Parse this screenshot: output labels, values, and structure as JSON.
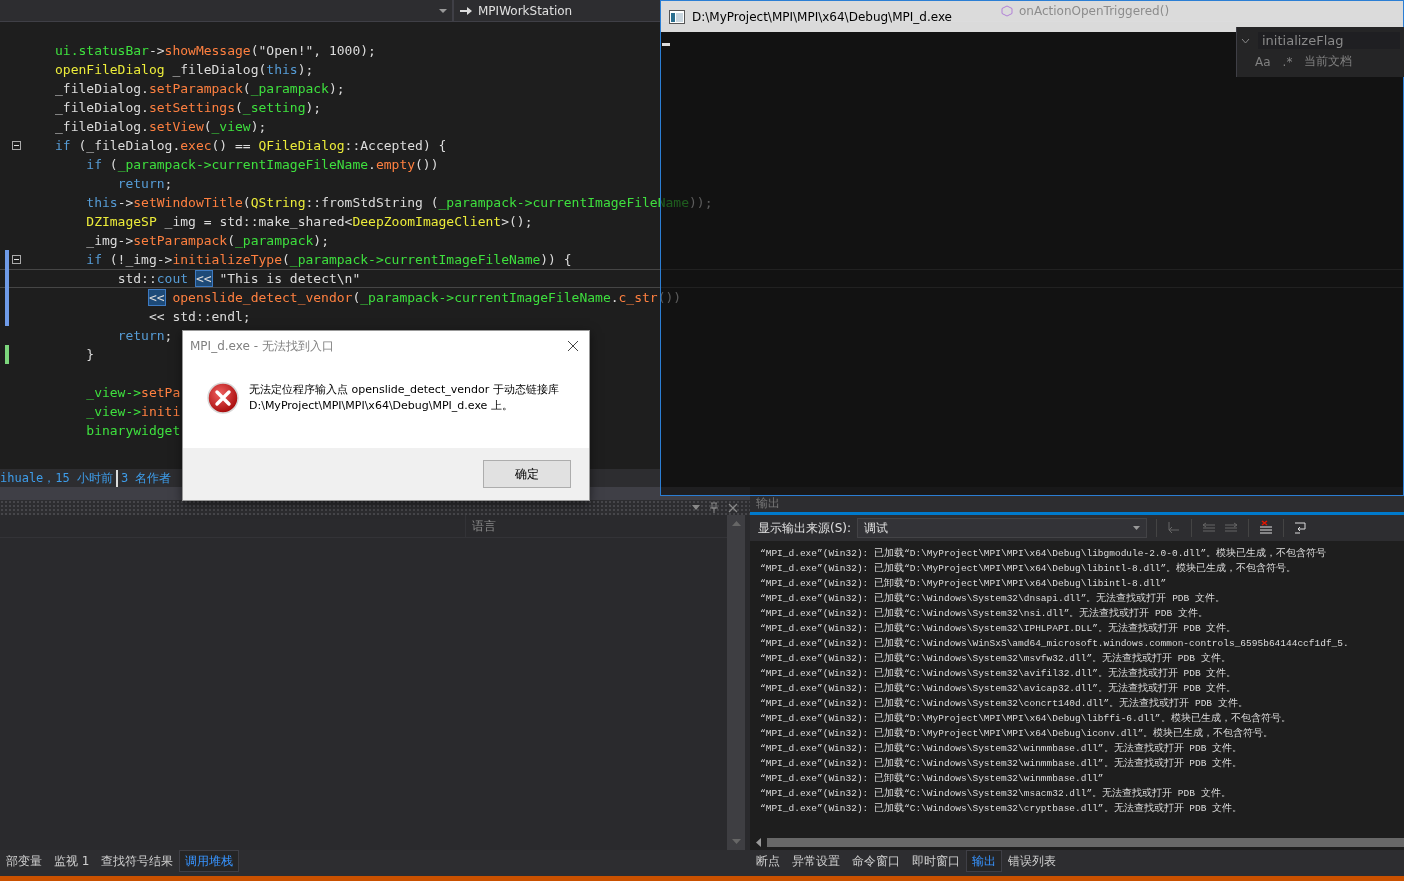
{
  "editor": {
    "navbar": {
      "project": "MPIWorkStation",
      "member": "onActionOpenTriggered()"
    },
    "blocks": [
      {
        "lines": [
          {
            "tokens": [
              {
                "text": "ui.statusBar",
                "kind": "member"
              },
              {
                "text": "->",
                "kind": "plain"
              },
              {
                "text": "showMessage",
                "kind": "function"
              },
              {
                "text": "(\"Open!\", 1000);",
                "kind": "plain"
              }
            ],
            "fold": false,
            "modified": false,
            "saved": false,
            "current": false
          },
          {
            "tokens": [
              {
                "text": "openFileDialog",
                "kind": "type"
              },
              {
                "text": " _fileDialog(",
                "kind": "plain"
              },
              {
                "text": "this",
                "kind": "keyword"
              },
              {
                "text": ");",
                "kind": "plain"
              }
            ],
            "fold": false,
            "modified": false,
            "saved": false,
            "current": false
          },
          {
            "tokens": [
              {
                "text": "_fileDialog.",
                "kind": "plain"
              },
              {
                "text": "setParampack",
                "kind": "function"
              },
              {
                "text": "(",
                "kind": "plain"
              },
              {
                "text": "_parampack",
                "kind": "member"
              },
              {
                "text": ");",
                "kind": "plain"
              }
            ],
            "fold": false,
            "modified": false,
            "saved": false,
            "current": false
          },
          {
            "tokens": [
              {
                "text": "_fileDialog.",
                "kind": "plain"
              },
              {
                "text": "setSettings",
                "kind": "function"
              },
              {
                "text": "(",
                "kind": "plain"
              },
              {
                "text": "_setting",
                "kind": "member"
              },
              {
                "text": ");",
                "kind": "plain"
              }
            ],
            "fold": false,
            "modified": false,
            "saved": false,
            "current": false
          },
          {
            "tokens": [
              {
                "text": "_fileDialog.",
                "kind": "plain"
              },
              {
                "text": "setView",
                "kind": "function"
              },
              {
                "text": "(",
                "kind": "plain"
              },
              {
                "text": "_view",
                "kind": "member"
              },
              {
                "text": ");",
                "kind": "plain"
              }
            ],
            "fold": false,
            "modified": false,
            "saved": false,
            "current": false
          },
          {
            "tokens": [
              {
                "text": "if",
                "kind": "keyword"
              },
              {
                "text": " (_fileDialog.",
                "kind": "plain"
              },
              {
                "text": "exec",
                "kind": "function"
              },
              {
                "text": "() == ",
                "kind": "plain"
              },
              {
                "text": "QFileDialog",
                "kind": "type"
              },
              {
                "text": "::Accepted) {",
                "kind": "plain"
              }
            ],
            "fold": true,
            "modified": false,
            "saved": false,
            "current": false
          },
          {
            "tokens": [
              {
                "text": "    if",
                "kind": "keyword"
              },
              {
                "text": " (",
                "kind": "plain"
              },
              {
                "text": "_parampack->currentImageFileName",
                "kind": "member"
              },
              {
                "text": ".",
                "kind": "plain"
              },
              {
                "text": "empty",
                "kind": "function"
              },
              {
                "text": "())",
                "kind": "plain"
              }
            ],
            "fold": false,
            "modified": false,
            "saved": false,
            "current": false
          },
          {
            "tokens": [
              {
                "text": "        return",
                "kind": "keyword"
              },
              {
                "text": ";",
                "kind": "plain"
              }
            ],
            "fold": false,
            "modified": false,
            "saved": false,
            "current": false
          },
          {
            "tokens": [
              {
                "text": "    this",
                "kind": "keyword"
              },
              {
                "text": "->",
                "kind": "plain"
              },
              {
                "text": "setWindowTitle",
                "kind": "function"
              },
              {
                "text": "(",
                "kind": "plain"
              },
              {
                "text": "QString",
                "kind": "type"
              },
              {
                "text": "::fromStdString (",
                "kind": "plain"
              },
              {
                "text": "_parampack->currentImageFileName",
                "kind": "member"
              },
              {
                "text": "));",
                "kind": "plain"
              }
            ],
            "fold": false,
            "modified": false,
            "saved": false,
            "current": false
          },
          {
            "tokens": [
              {
                "text": "    DZImageSP",
                "kind": "type"
              },
              {
                "text": " _img = std::make_shared<",
                "kind": "plain"
              },
              {
                "text": "DeepZoomImageClient",
                "kind": "type"
              },
              {
                "text": ">();",
                "kind": "plain"
              }
            ],
            "fold": false,
            "modified": false,
            "saved": false,
            "current": false
          },
          {
            "tokens": [
              {
                "text": "    _img->",
                "kind": "plain"
              },
              {
                "text": "setParampack",
                "kind": "function"
              },
              {
                "text": "(",
                "kind": "plain"
              },
              {
                "text": "_parampack",
                "kind": "member"
              },
              {
                "text": ");",
                "kind": "plain"
              }
            ],
            "fold": false,
            "modified": false,
            "saved": false,
            "current": false
          },
          {
            "tokens": [
              {
                "text": "    if",
                "kind": "keyword"
              },
              {
                "text": " (!_img->",
                "kind": "plain"
              },
              {
                "text": "initializeType",
                "kind": "function"
              },
              {
                "text": "(",
                "kind": "plain"
              },
              {
                "text": "_parampack->currentImageFileName",
                "kind": "member"
              },
              {
                "text": ")) {",
                "kind": "plain"
              }
            ],
            "fold": true,
            "modified": true,
            "saved": false,
            "current": false
          },
          {
            "tokens": [
              {
                "text": "        std::",
                "kind": "plain"
              },
              {
                "text": "cout ",
                "kind": "keyword"
              },
              {
                "text": "<<",
                "kind": "match"
              },
              {
                "text": " \"This is detect\\n\"",
                "kind": "plain"
              }
            ],
            "fold": false,
            "modified": true,
            "saved": false,
            "current": true
          },
          {
            "tokens": [
              {
                "text": "            <<",
                "kind": "match"
              },
              {
                "text": " openslide_detect_vendor",
                "kind": "function"
              },
              {
                "text": "(",
                "kind": "plain"
              },
              {
                "text": "_parampack->currentImageFileName",
                "kind": "member"
              },
              {
                "text": ".",
                "kind": "plain"
              },
              {
                "text": "c_str",
                "kind": "function"
              },
              {
                "text": "())",
                "kind": "plain"
              }
            ],
            "fold": false,
            "modified": true,
            "saved": false,
            "current": false
          },
          {
            "tokens": [
              {
                "text": "            << std::endl;",
                "kind": "plain"
              }
            ],
            "fold": false,
            "modified": true,
            "saved": false,
            "current": false
          },
          {
            "tokens": [
              {
                "text": "        return",
                "kind": "keyword"
              },
              {
                "text": ";",
                "kind": "plain"
              }
            ],
            "fold": false,
            "modified": false,
            "saved": false,
            "current": false
          },
          {
            "tokens": [
              {
                "text": "    }",
                "kind": "plain"
              }
            ],
            "fold": false,
            "modified": false,
            "saved": true,
            "current": false
          }
        ]
      },
      {
        "lines": [
          {
            "tokens": [
              {
                "text": "    _view->",
                "kind": "member"
              },
              {
                "text": "setPa",
                "kind": "function"
              }
            ],
            "fold": false,
            "modified": false,
            "saved": false,
            "current": false
          },
          {
            "tokens": [
              {
                "text": "    _view->",
                "kind": "member"
              },
              {
                "text": "initi",
                "kind": "function"
              }
            ],
            "fold": false,
            "modified": false,
            "saved": false,
            "current": false
          },
          {
            "tokens": [
              {
                "text": "    binarywidget",
                "kind": "member"
              }
            ],
            "fold": false,
            "modified": false,
            "saved": false,
            "current": false
          }
        ]
      }
    ],
    "find": {
      "query": "initializeFlag",
      "options": [
        "Aa",
        ".*"
      ],
      "scope": "当前文档"
    },
    "codelens": [
      "ihuale，15 小时前",
      "3 名作者"
    ]
  },
  "console": {
    "title": "D:\\MyProject\\MPI\\MPI\\x64\\Debug\\MPI_d.exe"
  },
  "dialog": {
    "title": "MPI_d.exe - 无法找到入口",
    "message": "无法定位程序输入点 openslide_detect_vendor 于动态链接库\nD:\\MyProject\\MPI\\MPI\\x64\\Debug\\MPI_d.exe 上。",
    "button": "确定"
  },
  "left_panel": {
    "columns": [
      "语言"
    ],
    "tabs": [
      {
        "label": "部变量",
        "selected": false
      },
      {
        "label": "监视 1",
        "selected": false
      },
      {
        "label": "查找符号结果",
        "selected": false
      },
      {
        "label": "调用堆栈",
        "selected": true
      }
    ]
  },
  "output_panel": {
    "title": "输出",
    "source_label": "显示输出来源(S):",
    "source": "调试",
    "lines": [
      "“MPI_d.exe”(Win32): 已加载“D:\\MyProject\\MPI\\MPI\\x64\\Debug\\libgmodule-2.0-0.dll”。模块已生成，不包含符号",
      "“MPI_d.exe”(Win32): 已加载“D:\\MyProject\\MPI\\MPI\\x64\\Debug\\libintl-8.dll”。模块已生成，不包含符号。",
      "“MPI_d.exe”(Win32): 已卸载“D:\\MyProject\\MPI\\MPI\\x64\\Debug\\libintl-8.dll”",
      "“MPI_d.exe”(Win32): 已加载“C:\\Windows\\System32\\dnsapi.dll”。无法查找或打开 PDB 文件。",
      "“MPI_d.exe”(Win32): 已加载“C:\\Windows\\System32\\nsi.dll”。无法查找或打开 PDB 文件。",
      "“MPI_d.exe”(Win32): 已加载“C:\\Windows\\System32\\IPHLPAPI.DLL”。无法查找或打开 PDB 文件。",
      "“MPI_d.exe”(Win32): 已加载“C:\\Windows\\WinSxS\\amd64_microsoft.windows.common-controls_6595b64144ccf1df_5.",
      "“MPI_d.exe”(Win32): 已加载“C:\\Windows\\System32\\msvfw32.dll”。无法查找或打开 PDB 文件。",
      "“MPI_d.exe”(Win32): 已加载“C:\\Windows\\System32\\avifil32.dll”。无法查找或打开 PDB 文件。",
      "“MPI_d.exe”(Win32): 已加载“C:\\Windows\\System32\\avicap32.dll”。无法查找或打开 PDB 文件。",
      "“MPI_d.exe”(Win32): 已加载“C:\\Windows\\System32\\concrt140d.dll”。无法查找或打开 PDB 文件。",
      "“MPI_d.exe”(Win32): 已加载“D:\\MyProject\\MPI\\MPI\\x64\\Debug\\libffi-6.dll”。模块已生成，不包含符号。",
      "“MPI_d.exe”(Win32): 已加载“D:\\MyProject\\MPI\\MPI\\x64\\Debug\\iconv.dll”。模块已生成，不包含符号。",
      "“MPI_d.exe”(Win32): 已加载“C:\\Windows\\System32\\winmmbase.dll”。无法查找或打开 PDB 文件。",
      "“MPI_d.exe”(Win32): 已加载“C:\\Windows\\System32\\winmmbase.dll”。无法查找或打开 PDB 文件。",
      "“MPI_d.exe”(Win32): 已卸载“C:\\Windows\\System32\\winmmbase.dll”",
      "“MPI_d.exe”(Win32): 已加载“C:\\Windows\\System32\\msacm32.dll”。无法查找或打开 PDB 文件。",
      "“MPI_d.exe”(Win32): 已加载“C:\\Windows\\System32\\cryptbase.dll”。无法查找或打开 PDB 文件。"
    ],
    "tabs": [
      {
        "label": "断点",
        "selected": false
      },
      {
        "label": "异常设置",
        "selected": false
      },
      {
        "label": "命令窗口",
        "selected": false
      },
      {
        "label": "即时窗口",
        "selected": false
      },
      {
        "label": "输出",
        "selected": true
      },
      {
        "label": "错误列表",
        "selected": false
      }
    ]
  }
}
